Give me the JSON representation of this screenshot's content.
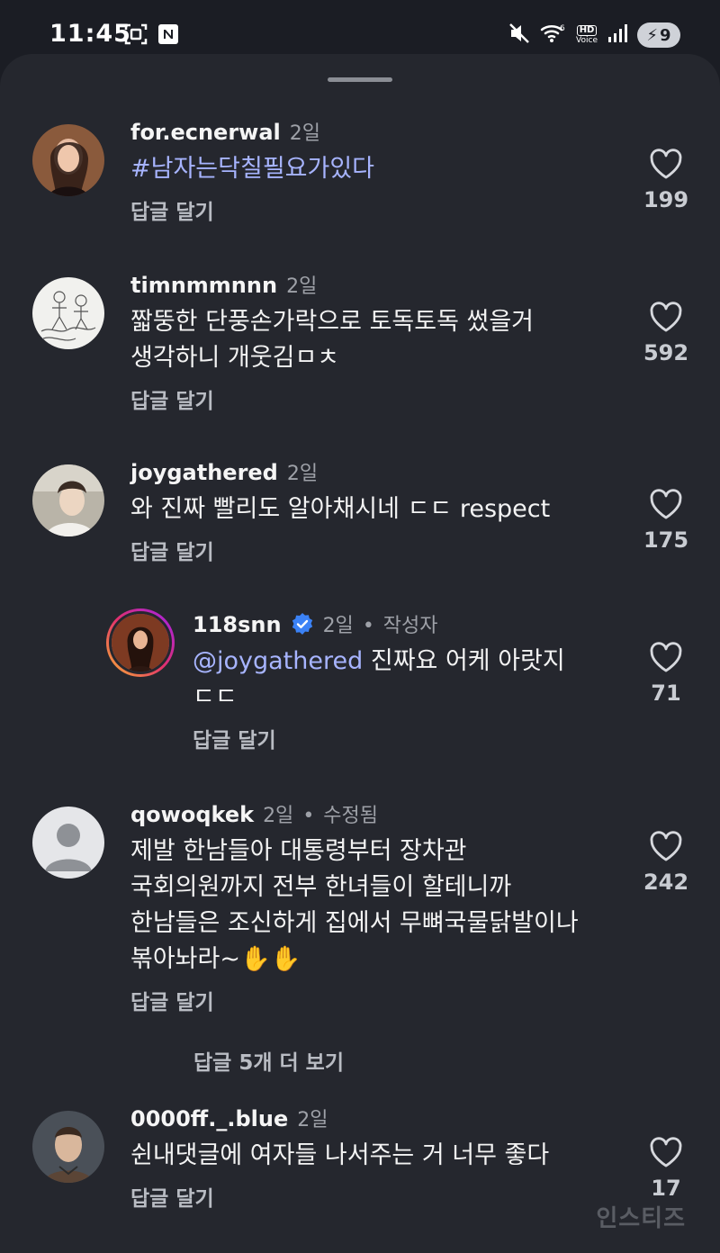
{
  "status_bar": {
    "time": "11:45",
    "left_icons": [
      "screenshot-icon",
      "notification-n-icon"
    ],
    "right_icons": [
      "mute-icon",
      "wifi-icon",
      "hd-voice-icon",
      "signal-icon"
    ],
    "hd_label": "HD",
    "voice_label": "Voice",
    "battery": "9"
  },
  "comments": [
    {
      "username": "for.ecnerwal",
      "time": "2일",
      "text": "#남자는닥칠필요가있다",
      "text_is_hashtag": true,
      "reply_label": "답글 달기",
      "likes": "199"
    },
    {
      "username": "timnmmnnn",
      "time": "2일",
      "text_lines": [
        "짧뚱한 단풍손가락으로 토독토독 썼을거",
        "생각하니 개웃김ㅁㅊ"
      ],
      "reply_label": "답글 달기",
      "likes": "592"
    },
    {
      "username": "joygathered",
      "time": "2일",
      "text": "와 진짜 빨리도 알아채시네 ㄷㄷ respect",
      "reply_label": "답글 달기",
      "likes": "175"
    },
    {
      "username": "118snn",
      "verified": true,
      "time": "2일",
      "separator": "•",
      "badge": "작성자",
      "mention": "@joygathered",
      "text_after_mention": " 진짜요 어케 아랏지",
      "text_line2": "ㄷㄷ",
      "reply_label": "답글 달기",
      "likes": "71"
    },
    {
      "username": "qowoqkek",
      "time": "2일",
      "separator": "•",
      "badge": "수정됨",
      "text_lines": [
        "제발 한남들아 대통령부터 장차관",
        "국회의원까지 전부 한녀들이 할테니까",
        "한남들은 조신하게 집에서 무뼈국물닭발이나",
        "볶아놔라~✋✋"
      ],
      "reply_label": "답글 달기",
      "likes": "242"
    },
    {
      "username": "0000ff._.blue",
      "time": "2일",
      "text": "쉰내댓글에 여자들 나서주는 거 너무 좋다",
      "reply_label": "답글 달기",
      "likes": "17"
    }
  ],
  "more_replies_label": "답글 5개 더 보기",
  "watermark": "인스티즈",
  "colors": {
    "background": "#25272e",
    "status_background": "#1b1d24",
    "mention": "#a7b4ff",
    "verified": "#3b82f6",
    "meta": "#9ea1a8"
  }
}
